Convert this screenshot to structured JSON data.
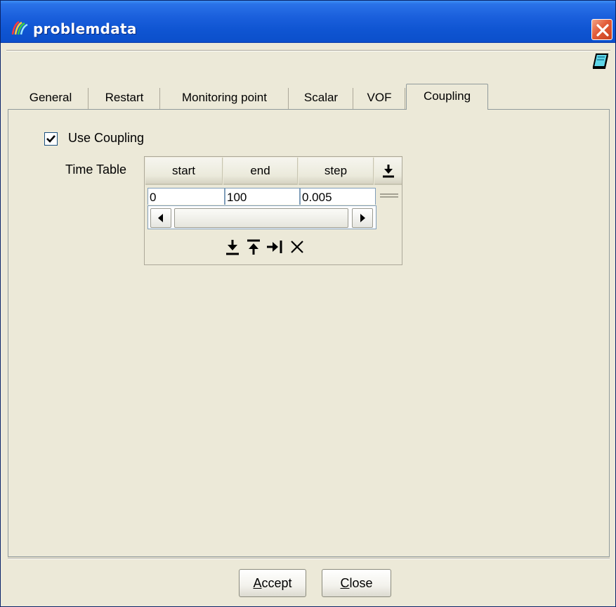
{
  "window": {
    "title": "problemdata",
    "close_label": "×"
  },
  "tabs": [
    {
      "label": "General",
      "active": false
    },
    {
      "label": "Restart",
      "active": false
    },
    {
      "label": "Monitoring point",
      "active": false
    },
    {
      "label": "Scalar",
      "active": false
    },
    {
      "label": "VOF",
      "active": false
    },
    {
      "label": "Coupling",
      "active": true
    }
  ],
  "coupling": {
    "use_coupling_label": "Use Coupling",
    "use_coupling_checked": true,
    "time_table": {
      "label": "Time Table",
      "columns": [
        "start",
        "end",
        "step"
      ],
      "rows": [
        [
          "0",
          "100",
          "0.005"
        ]
      ]
    }
  },
  "icons": {
    "app": "app-logo-icon",
    "help": "help-book-icon",
    "add_row_end": "insert-row-below-icon",
    "insert_below": "insert-below-icon",
    "insert_above": "insert-above-icon",
    "append": "append-row-icon",
    "delete": "delete-row-icon"
  },
  "buttons": {
    "accept_mnemonic": "A",
    "accept_rest": "ccept",
    "close_mnemonic": "C",
    "close_rest": "lose"
  },
  "colors": {
    "titlebar": "#0b4fcb",
    "window_bg": "#ece9d8",
    "close_button": "#e25c3a"
  }
}
